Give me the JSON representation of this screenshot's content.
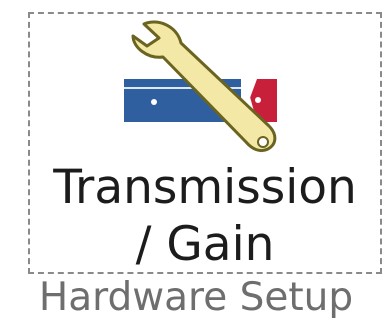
{
  "ribbon": {
    "button": {
      "label_line1": "Transmission",
      "label_line2": "/ Gain",
      "icon": "wrench-icon"
    },
    "group_label": "Hardware Setup"
  },
  "colors": {
    "board_blue": "#2f5f9e",
    "board_red": "#c8203a",
    "wrench_fill": "#f3e8a6",
    "wrench_outline": "#6b6420",
    "border": "#8a8a8a",
    "label_text": "#1c1c1c",
    "group_text": "#6e6e6e"
  }
}
